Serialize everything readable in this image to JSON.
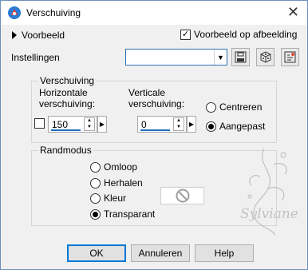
{
  "window": {
    "title": "Verschuiving",
    "close_glyph": "✕"
  },
  "preview": {
    "toggle_label": "Voorbeeld",
    "checkbox_label": "Voorbeeld op afbeelding",
    "checked": true
  },
  "settings": {
    "label": "Instellingen",
    "combo_value": "",
    "buttons": [
      "save-icon",
      "dice-icon",
      "reset-icon"
    ]
  },
  "offset_group": {
    "title": "Verschuiving",
    "horizontal_label_1": "Horizontale",
    "horizontal_label_2": "verschuiving:",
    "horizontal_value": "150",
    "vertical_label_1": "Verticale",
    "vertical_label_2": "verschuiving:",
    "vertical_value": "0",
    "radios": [
      {
        "label": "Centreren",
        "selected": false
      },
      {
        "label": "Aangepast",
        "selected": true
      }
    ]
  },
  "edge_group": {
    "title": "Randmodus",
    "radios": [
      {
        "label": "Omloop",
        "selected": false
      },
      {
        "label": "Herhalen",
        "selected": false
      },
      {
        "label": "Kleur",
        "selected": false
      },
      {
        "label": "Transparant",
        "selected": true
      }
    ]
  },
  "watermark": {
    "text": "Sylviane"
  },
  "buttons": {
    "ok": "OK",
    "cancel": "Annuleren",
    "help": "Help"
  },
  "colors": {
    "accent": "#0078d7",
    "title_bg": "#ffffff",
    "dialog_bg": "#f0f0f0"
  }
}
